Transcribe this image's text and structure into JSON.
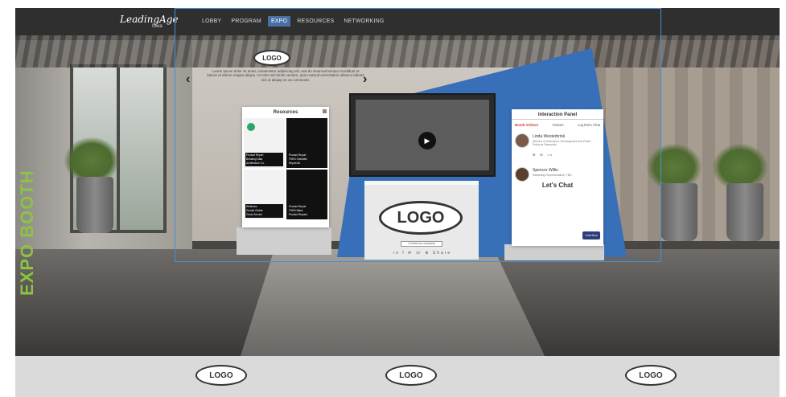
{
  "topbar": {
    "brand": "LeadingAge",
    "brand_sub": "Iowa",
    "nav": [
      "LOBBY",
      "PROGRAM",
      "EXPO",
      "RESOURCES",
      "NETWORKING"
    ],
    "active_nav": "EXPO"
  },
  "side_label": "EXPO BOOTH",
  "booth": {
    "top_logo": "LOGO",
    "intro_text": "Lorem ipsum dolor sit amet, consectetur adipiscing elit, sed do eiusmod tempor incididunt ut labore et dolore magna aliqua. Ut enim ad minim veniam, quis nostrud exercitation ullamco laboris nisi ut aliquip ex ea commodo.",
    "arrow_left": "‹",
    "arrow_right": "›",
    "resources": {
      "title": "Resources",
      "captions": [
        "Product Report\nBreaking Data\nArchitecture Co.",
        "Product Report\nTHEN Checklist\nReport Ab",
        "Webinars\nGrowth Global\nCloud Service",
        "Product Report\nTHEN Black\nProduct Reports"
      ]
    },
    "counter_logo": "LOGO",
    "counter_button": "Contact our company",
    "counter_social": "in f ✉ ☏ ⊕ Share",
    "interaction": {
      "title": "Interaction Panel",
      "tabs": [
        "Booth Visitors",
        "Visitors",
        "Log them Chat"
      ],
      "people": [
        {
          "name": "Linda Westerbrink",
          "role": "Director of Education, Development and Public Policy at Diamonds",
          "icons": "✉ ☏ in"
        },
        {
          "name": "Spencer Willis",
          "role": "Marketing Representative, TBD"
        }
      ],
      "lets_chat": "Let's Chat",
      "chat_button": "Chat Now"
    }
  },
  "footer": {
    "logos": [
      "LOGO",
      "LOGO",
      "LOGO"
    ]
  },
  "colors": {
    "accent_green": "#8ac440",
    "nav_active": "#4a6fa5",
    "booth_blue": "#3770b8",
    "frame_blue": "#4a8fd0"
  }
}
